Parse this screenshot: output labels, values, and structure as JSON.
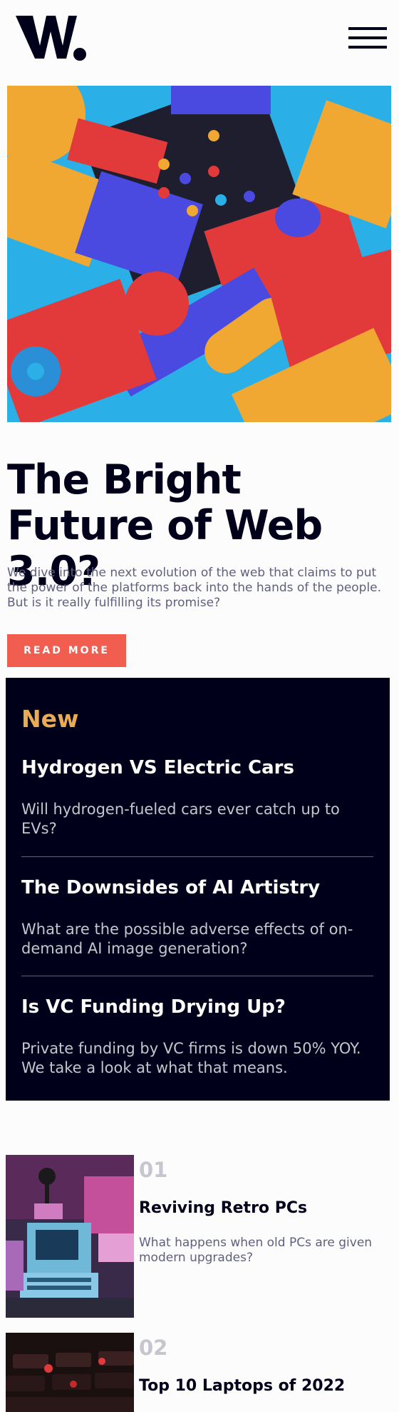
{
  "header": {
    "logo_alt": "W.",
    "menu_icon": "hamburger-menu-icon"
  },
  "hero": {
    "title": "The Bright Future of Web 3.0?",
    "description": "We dive into the next evolution of the web that claims to put the power of the platforms back into the hands of the people. But is it really fulfilling its promise?",
    "button_label": "READ MORE"
  },
  "new_panel": {
    "heading": "New",
    "items": [
      {
        "title": "Hydrogen VS Electric Cars",
        "description": "Will hydrogen-fueled cars ever catch up to EVs?"
      },
      {
        "title": "The Downsides of AI Artistry",
        "description": "What are the possible adverse effects of on-demand AI image generation?"
      },
      {
        "title": "Is VC Funding Drying Up?",
        "description": "Private funding by VC firms is down 50% YOY. We take a look at what that means."
      }
    ]
  },
  "list": [
    {
      "number": "01",
      "title": "Reviving Retro PCs",
      "description": "What happens when old PCs are given modern upgrades?"
    },
    {
      "number": "02",
      "title": "Top 10 Laptops of 2022",
      "description": ""
    }
  ],
  "colors": {
    "dark_navy": "#00001a",
    "soft_red": "#f15e50",
    "soft_orange": "#e9ab53",
    "grayish_blue": "#5e607e",
    "off_white": "#fdfcfd"
  }
}
